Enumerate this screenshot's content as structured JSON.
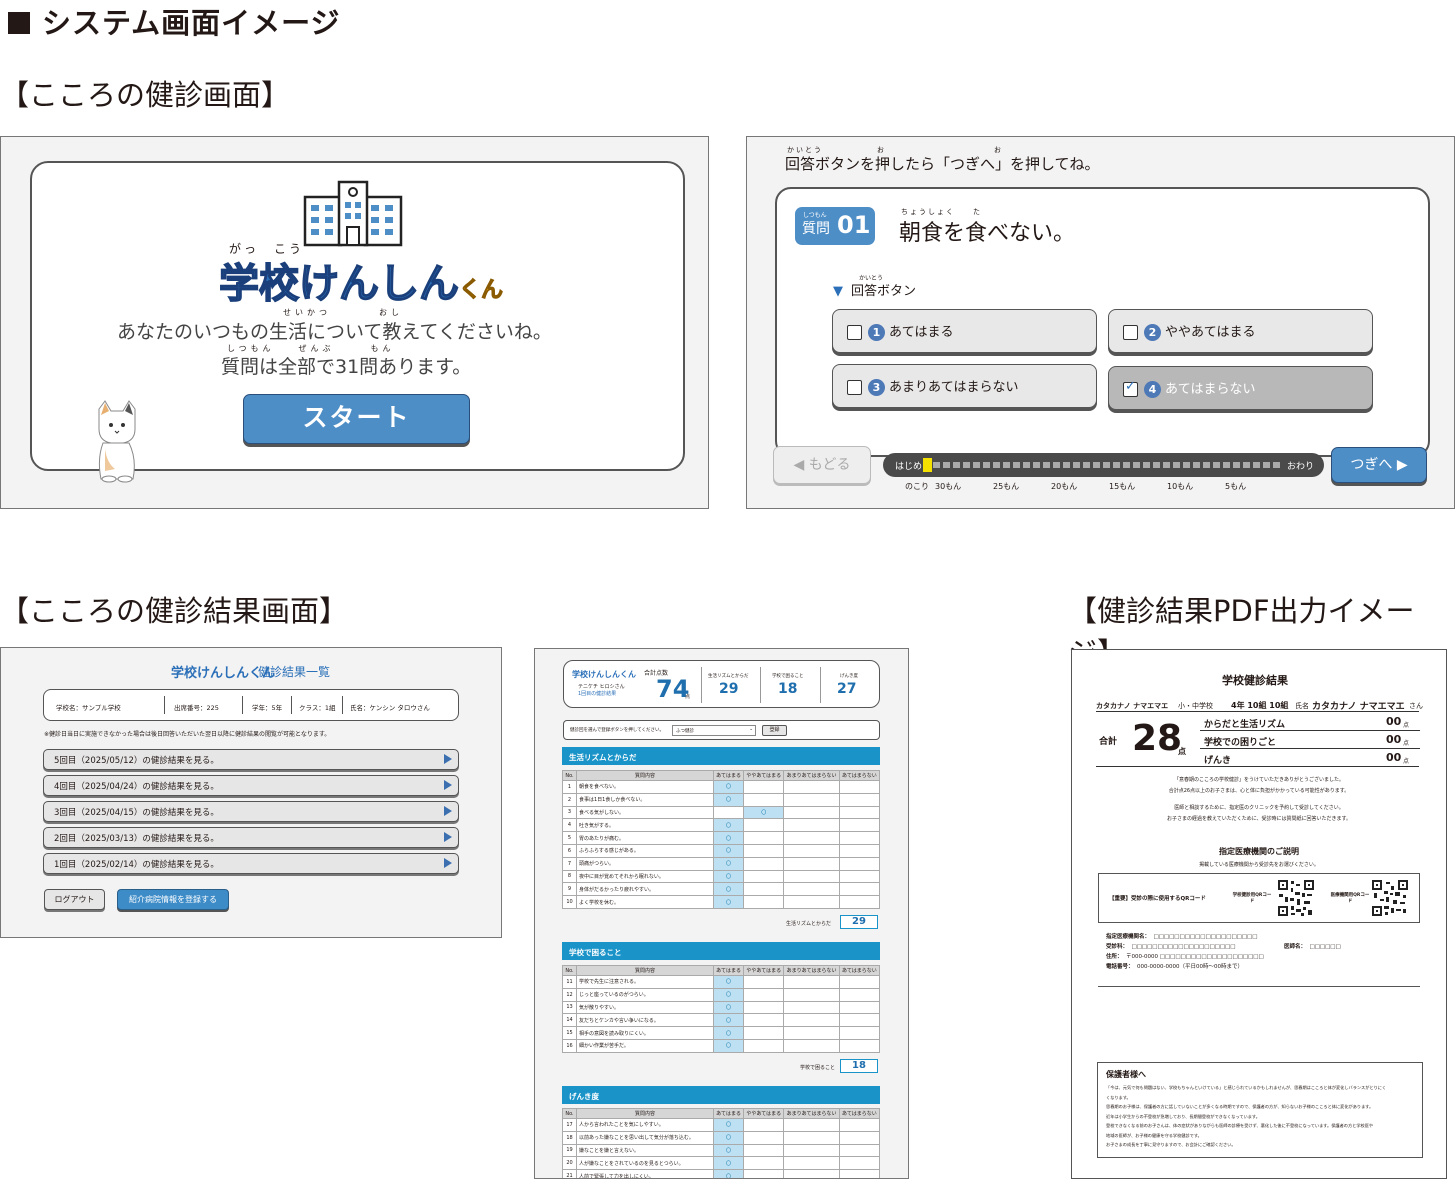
{
  "heading": "システム画面イメージ",
  "sections": {
    "kokoro": "【こころの健診画面】",
    "result": "【こころの健診結果画面】",
    "pdf": "【健診結果PDF出力イメージ】"
  },
  "start_screen": {
    "logo_ruby_gakkou": "がっ　こう",
    "logo_text": "学校けんしん",
    "logo_suffix": "くん",
    "line1": "あなたのいつもの生活について教えてくださいね。",
    "line1_ruby": "せいかつ　　　　おし",
    "line2": "質問は全部で31問あります。",
    "line2_ruby": "しつもん　　ぜんぶ　　　もん",
    "start_label": "スタート"
  },
  "question_screen": {
    "instruction_ruby": "かいとう　　　　　　お　　　　　　　　　　　　お",
    "instruction": "回答ボタンを押したら「つぎへ」を押してね。",
    "badge_ruby": "しつもん",
    "badge_label": "質問",
    "badge_num": "01",
    "question_ruby": "ちょうしょく　　た",
    "question": "朝食を食べない。",
    "answer_header_ruby": "かいとう",
    "answer_header": "回答ボタン",
    "options": [
      {
        "num": "1",
        "label": "あてはまる",
        "checked": false
      },
      {
        "num": "2",
        "label": "ややあてはまる",
        "checked": false
      },
      {
        "num": "3",
        "label": "あまりあてはまらない",
        "checked": false
      },
      {
        "num": "4",
        "label": "あてはまらない",
        "checked": true
      }
    ],
    "back_label": "もどる",
    "next_label": "つぎへ",
    "progress_start": "はじめ",
    "progress_end": "おわり",
    "progress_value": 0.0,
    "remaining_label": "のこり",
    "ticks": [
      "30もん",
      "25もん",
      "20もん",
      "15もん",
      "10もん",
      "5もん"
    ]
  },
  "result_list": {
    "logo": "学校けんしんくん",
    "title": "健診結果一覧",
    "info": {
      "school": "学校名：サンプル学校",
      "number": "出席番号：225",
      "grade": "学年：5年",
      "class": "クラス：1組",
      "name": "氏名：ケンシン タロウさん"
    },
    "note": "※健診日当日に実施できなかった場合は後日回答いただいた翌日以降に健診結果の閲覧が可能となります。",
    "rows": [
      "5回目（2025/05/12）の健診結果を見る。",
      "4回目（2025/04/24）の健診結果を見る。",
      "3回目（2025/04/15）の健診結果を見る。",
      "2回目（2025/03/13）の健診結果を見る。",
      "1回目（2025/02/14）の健診結果を見る。"
    ],
    "logout_label": "ログアウト",
    "register_label": "紹介病院情報を登録する"
  },
  "result_detail": {
    "logo": "学校けんしんくん",
    "student_name": "テニケチ ヒロシさん",
    "session": "1回目の健診結果",
    "total_label": "合計点数",
    "total": "74",
    "unit": "点",
    "scores": [
      {
        "label": "生活リズムとからだ",
        "value": "29"
      },
      {
        "label": "学校で困ること",
        "value": "18"
      },
      {
        "label": "げんき度",
        "value": "27"
      }
    ],
    "select_prompt": "健診回を選んで登録ボタンを押してください。",
    "select_value": "ふつ健診",
    "register_label": "登録",
    "columns": [
      "No.",
      "質問内容",
      "あてはまる",
      "ややあてはまる",
      "あまりあてはまらない",
      "あてはまらない"
    ],
    "mark": "〇",
    "sections": [
      {
        "title": "生活リズムとからだ",
        "subtotal_label": "生活リズムとからだ",
        "subtotal": "29",
        "rows": [
          {
            "no": "1",
            "text": "朝食を食べない。",
            "col": 2
          },
          {
            "no": "2",
            "text": "食事は1日1食しか食べない。",
            "col": 2
          },
          {
            "no": "3",
            "text": "食べる気がしない。",
            "col": 3
          },
          {
            "no": "4",
            "text": "吐き気がする。",
            "col": 2
          },
          {
            "no": "5",
            "text": "胃のあたりが痛む。",
            "col": 2
          },
          {
            "no": "6",
            "text": "ふらふらする感じがある。",
            "col": 2
          },
          {
            "no": "7",
            "text": "頭痛がつらい。",
            "col": 2
          },
          {
            "no": "8",
            "text": "夜中に目が覚めてそれから眠れない。",
            "col": 2
          },
          {
            "no": "9",
            "text": "身体がだるかったり疲れやすい。",
            "col": 2
          },
          {
            "no": "10",
            "text": "よく学校を休む。",
            "col": 2
          }
        ]
      },
      {
        "title": "学校で困ること",
        "subtotal_label": "学校で困ること",
        "subtotal": "18",
        "rows": [
          {
            "no": "11",
            "text": "学校で先生に注意される。",
            "col": 2
          },
          {
            "no": "12",
            "text": "じっと座っているのがつらい。",
            "col": 2
          },
          {
            "no": "13",
            "text": "気が散りやすい。",
            "col": 2
          },
          {
            "no": "14",
            "text": "友だちとケンカや言い争いになる。",
            "col": 2
          },
          {
            "no": "15",
            "text": "相手の意図を読み取りにくい。",
            "col": 2
          },
          {
            "no": "16",
            "text": "細かい作業が苦手だ。",
            "col": 2
          }
        ]
      },
      {
        "title": "げんき度",
        "rows": [
          {
            "no": "17",
            "text": "人から言われたことを気にしやすい。",
            "col": 2
          },
          {
            "no": "18",
            "text": "以前あった嫌なことを思い出して気分が落ち込む。",
            "col": 2
          },
          {
            "no": "19",
            "text": "嫌なことを嫌と言えない。",
            "col": 2
          },
          {
            "no": "20",
            "text": "人が嫌なことをされているのを見るとつらい。",
            "col": 2
          },
          {
            "no": "21",
            "text": "人前で緊張して力を出しにくい。",
            "col": 2
          }
        ]
      }
    ]
  },
  "pdf": {
    "title": "学校健診結果",
    "kana_name": "カタカナノ ナマエマエ",
    "school": "小・中学校",
    "grade_class": "4年 10組 10組",
    "name_label": "氏名",
    "name": "カタカナノ ナマエマエ",
    "name_suffix": "さん",
    "total_label": "合計",
    "total": "28",
    "unit": "点",
    "rows": [
      {
        "label": "からだと生活リズム",
        "value": "00"
      },
      {
        "label": "学校での困りごと",
        "value": "00"
      },
      {
        "label": "げんき",
        "value": "00"
      }
    ],
    "message1": "「意春期のこころの学校健診」をうけていただきありがとうございました。",
    "message2": "合計点26点以上のお子さまは、心と体に負担がかかっている可能性があります。",
    "message3": "医師と相談するために、指定医のクリニックを予約して受診してください。",
    "message4": "お子さまの経過を教えていただくために、受診時には質問紙に回答いただきます。",
    "facility_title": "指定医療機関のご説明",
    "facility_sub": "掲載している医療機関から受診先をお選びください。",
    "qr_label": "【重要】受診の際に使用するQRコード",
    "qr1_label": "学校健診用QRコード",
    "qr2_label": "医療機関用QRコード",
    "fields": [
      {
        "label": "指定医療機関名：",
        "value": "□□□□□□□□□□□□□□□□□□□□"
      },
      {
        "label": "受診科：",
        "value": "□□□□□□□□□□□□□□□□□□□□"
      },
      {
        "label": "住所：",
        "value": "〒000-0000 □□□□□□□□□□□□□□□□□□□□"
      },
      {
        "label": "電話番号：",
        "value": "000-0000-0000（平日00時〜00時まで）"
      }
    ],
    "doctor_label": "医師名：",
    "doctor_value": "□□□□□□",
    "guardian_title": "保護者様へ",
    "guardian_lines": [
      "「今は、元気で何も問題はない、学校もちゃんといけている」と感じられているかもしれませんが、思春期はこころと体が変化しバランスがとりにく",
      "くなります。",
      "思春期のお子様は、保護者の方に話していないことが多くなる時期ですので、保護者の方が、知らないお子様のこころと体に変化があります。",
      "近年は小学生からの不登校が急増しており、長期間登校ができなくなっています。",
      "登校できなくなる前のお子さんは、体の症状がありながらも医師の診療を受けず、悪化した後に不登校になっています。保護者の方と学校医や",
      "地域の医師が、お子様の健康を守る学校健診です。",
      "お子さまの成長を丁寧に見守りますので、お会計にご確認ください。"
    ]
  },
  "colors": {
    "accent_blue": "#4e8ec7",
    "bar_blue": "#1993c8",
    "logo_blue": "#2a6fb8",
    "logo_orange": "#f0a400"
  }
}
